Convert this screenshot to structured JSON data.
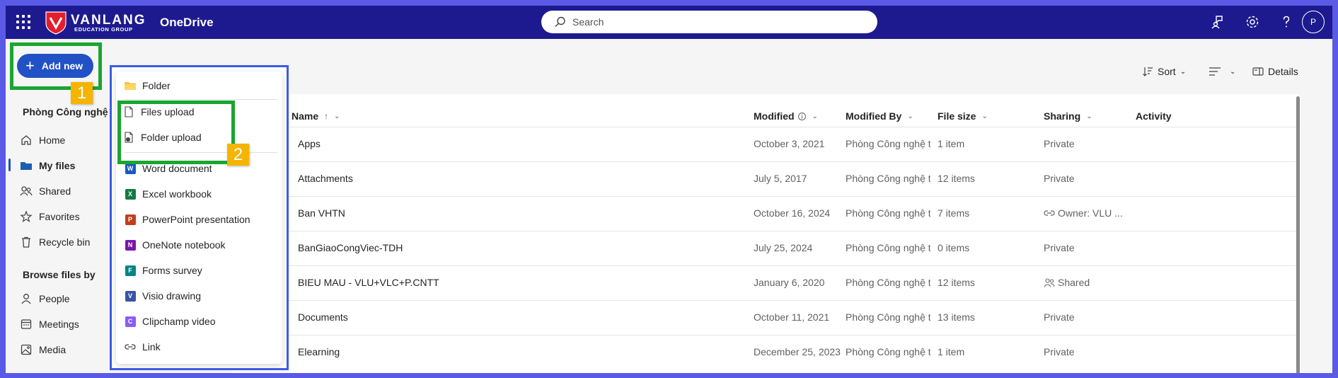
{
  "app": {
    "brand_name": "VANLANG",
    "brand_sub": "EDUCATION GROUP",
    "title": "OneDrive",
    "search_placeholder": "Search",
    "avatar_initial": "P"
  },
  "sidebar": {
    "add_new_label": "Add new",
    "section_owner": "Phòng Công nghệ t",
    "items": [
      {
        "label": "Home",
        "icon": "home-icon"
      },
      {
        "label": "My files",
        "icon": "folder-icon",
        "active": true
      },
      {
        "label": "Shared",
        "icon": "people-icon"
      },
      {
        "label": "Favorites",
        "icon": "star-icon"
      },
      {
        "label": "Recycle bin",
        "icon": "trash-icon"
      }
    ],
    "browse_title": "Browse files by",
    "browse_items": [
      {
        "label": "People",
        "icon": "person-icon"
      },
      {
        "label": "Meetings",
        "icon": "calendar-icon"
      },
      {
        "label": "Media",
        "icon": "image-icon"
      }
    ]
  },
  "menu": {
    "items": [
      {
        "label": "Folder",
        "icon": "folder-icon"
      },
      {
        "label": "Files upload",
        "icon": "file-upload-icon"
      },
      {
        "label": "Folder upload",
        "icon": "folder-upload-icon"
      },
      {
        "label": "Word document",
        "icon": "word-icon"
      },
      {
        "label": "Excel workbook",
        "icon": "excel-icon"
      },
      {
        "label": "PowerPoint presentation",
        "icon": "powerpoint-icon"
      },
      {
        "label": "OneNote notebook",
        "icon": "onenote-icon"
      },
      {
        "label": "Forms survey",
        "icon": "forms-icon"
      },
      {
        "label": "Visio drawing",
        "icon": "visio-icon"
      },
      {
        "label": "Clipchamp video",
        "icon": "clipchamp-icon"
      },
      {
        "label": "Link",
        "icon": "link-icon"
      }
    ]
  },
  "annotations": {
    "step1": "1",
    "step2": "2"
  },
  "toolbar": {
    "sort_label": "Sort",
    "details_label": "Details"
  },
  "table": {
    "headers": {
      "name": "Name",
      "name_sort": "↑",
      "modified": "Modified",
      "modified_by": "Modified By",
      "file_size": "File size",
      "sharing": "Sharing",
      "activity": "Activity"
    },
    "rows": [
      {
        "name": "Apps",
        "modified": "October 3, 2021",
        "modified_by": "Phòng Công nghệ t",
        "size": "1 item",
        "sharing": "Private"
      },
      {
        "name": "Attachments",
        "modified": "July 5, 2017",
        "modified_by": "Phòng Công nghệ t",
        "size": "12 items",
        "sharing": "Private"
      },
      {
        "name": "Ban VHTN",
        "modified": "October 16, 2024",
        "modified_by": "Phòng Công nghệ t",
        "size": "7 items",
        "sharing": "Owner: VLU ..."
      },
      {
        "name": "BanGiaoCongViec-TDH",
        "modified": "July 25, 2024",
        "modified_by": "Phòng Công nghệ t",
        "size": "0 items",
        "sharing": "Private"
      },
      {
        "name": "BIEU MAU - VLU+VLC+P.CNTT",
        "modified": "January 6, 2020",
        "modified_by": "Phòng Công nghệ t",
        "size": "12 items",
        "sharing": "Shared"
      },
      {
        "name": "Documents",
        "modified": "October 11, 2021",
        "modified_by": "Phòng Công nghệ t",
        "size": "13 items",
        "sharing": "Private"
      },
      {
        "name": "Elearning",
        "modified": "December 25, 2023",
        "modified_by": "Phòng Công nghệ t",
        "size": "1 item",
        "sharing": "Private"
      }
    ]
  },
  "colors": {
    "topbar": "#1d1a8f",
    "accent": "#2151c5",
    "highlight_green": "#1aa531",
    "highlight_blue": "#3b5ce8",
    "badge": "#f5b400"
  }
}
